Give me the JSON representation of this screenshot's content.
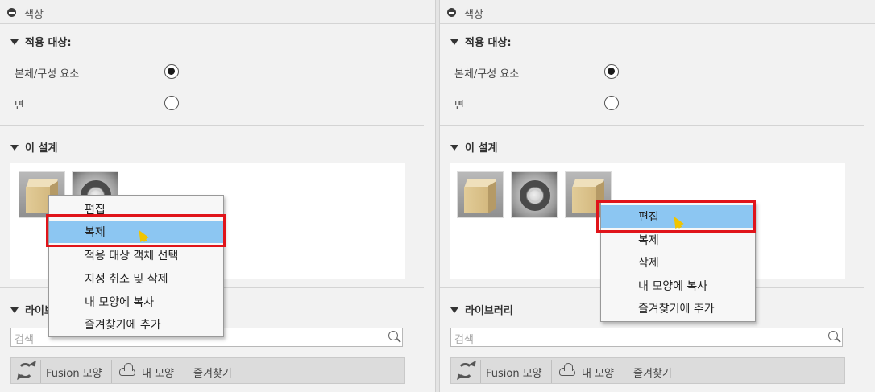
{
  "panels": [
    {
      "header_title": "색상",
      "apply_to": {
        "title": "적용 대상:",
        "options": [
          {
            "label": "본체/구성 요소",
            "selected": true
          },
          {
            "label": "면",
            "selected": false
          }
        ]
      },
      "this_design": {
        "title": "이 설계",
        "swatches": [
          "wood-cube-thumbnail",
          "metal-ring-thumbnail"
        ]
      },
      "context_menu": {
        "items": [
          "편집",
          "복제",
          "적용 대상 객체 선택",
          "지정 취소 및 삭제",
          "내 모양에 복사",
          "즐겨찾기에 추가"
        ],
        "highlighted": "복제"
      },
      "library": {
        "title": "라이브러리",
        "search_placeholder": "검색",
        "tabs": [
          "Fusion 모양",
          "내 모양",
          "즐겨찾기"
        ]
      }
    },
    {
      "header_title": "색상",
      "apply_to": {
        "title": "적용 대상:",
        "options": [
          {
            "label": "본체/구성 요소",
            "selected": true
          },
          {
            "label": "면",
            "selected": false
          }
        ]
      },
      "this_design": {
        "title": "이 설계",
        "swatches": [
          "wood-cube-thumbnail",
          "metal-ring-thumbnail",
          "wood-cube-thumbnail"
        ]
      },
      "context_menu": {
        "items": [
          "편집",
          "복제",
          "삭제",
          "내 모양에 복사",
          "즐겨찾기에 추가"
        ],
        "highlighted": "편집"
      },
      "library": {
        "title": "라이브러리",
        "search_placeholder": "검색",
        "tabs": [
          "Fusion 모양",
          "내 모양",
          "즐겨찾기"
        ]
      }
    }
  ],
  "colors": {
    "highlight": "#8cc6f2",
    "annotation_box": "#e0141a",
    "cursor": "#f0c400"
  }
}
